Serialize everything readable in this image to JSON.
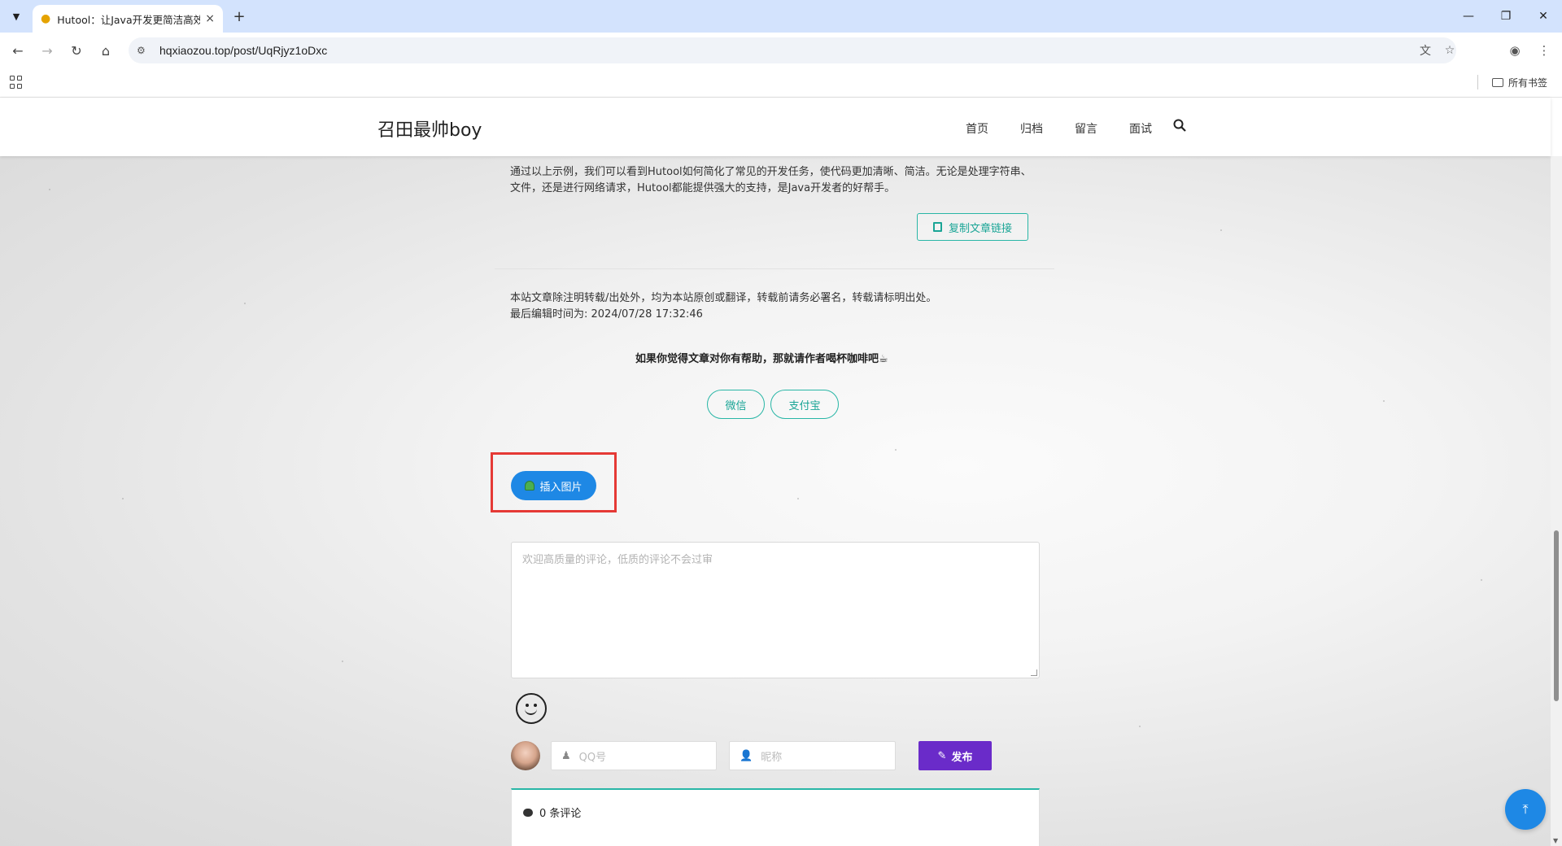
{
  "browser": {
    "tab_title": "Hutool：让Java开发更简洁高效",
    "tab_close": "×",
    "new_tab": "+",
    "url": "hqxiaozou.top/post/UqRjyz1oDxc",
    "bookmarks_label": "所有书签"
  },
  "site": {
    "brand": "召田最帅boy",
    "nav": [
      "首页",
      "归档",
      "留言",
      "面试"
    ]
  },
  "article": {
    "conclusion": "通过以上示例，我们可以看到Hutool如何简化了常见的开发任务，使代码更加清晰、简洁。无论是处理字符串、文件，还是进行网络请求，Hutool都能提供强大的支持，是Java开发者的好帮手。",
    "copy_link_label": "复制文章链接",
    "copyright_notice": "本站文章除注明转载/出处外，均为本站原创或翻译，转载前请务必署名，转载请标明出处。",
    "last_edited": "最后编辑时间为: 2024/07/28 17:32:46",
    "donate_prompt": "如果你觉得文章对你有帮助，那就请作者喝杯咖啡吧☕",
    "pay_wechat": "微信",
    "pay_alipay": "支付宝"
  },
  "comment_form": {
    "insert_image_label": "插入图片",
    "textarea_placeholder": "欢迎高质量的评论，低质的评论不会过审",
    "qq_placeholder": "QQ号",
    "nickname_placeholder": "昵称",
    "publish_label": "发布",
    "comment_count_label": "0 条评论"
  },
  "colors": {
    "accent_teal": "#29b6a6",
    "button_blue": "#1e88e5",
    "publish_purple": "#6a2bc9",
    "highlight_red": "#e53935"
  }
}
